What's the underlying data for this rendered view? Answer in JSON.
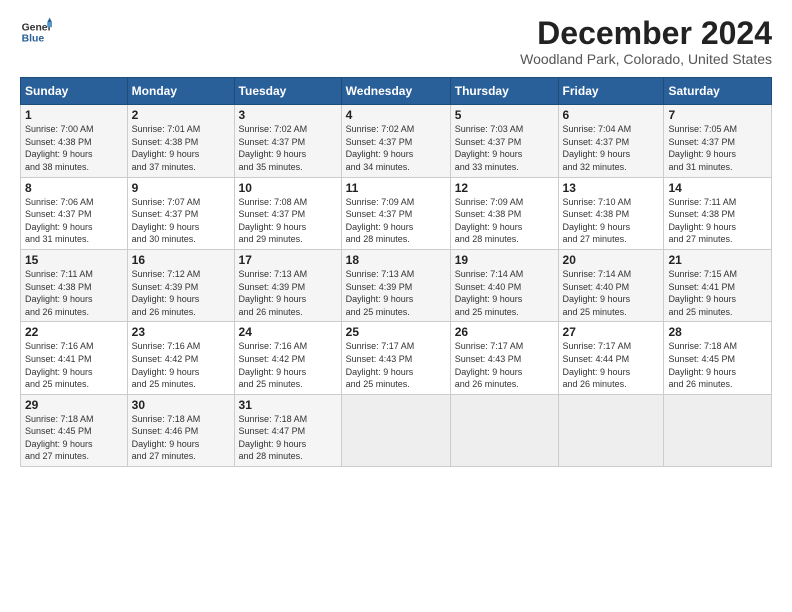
{
  "logo": {
    "line1": "General",
    "line2": "Blue"
  },
  "title": "December 2024",
  "location": "Woodland Park, Colorado, United States",
  "days_header": [
    "Sunday",
    "Monday",
    "Tuesday",
    "Wednesday",
    "Thursday",
    "Friday",
    "Saturday"
  ],
  "weeks": [
    [
      {
        "day": "1",
        "info": "Sunrise: 7:00 AM\nSunset: 4:38 PM\nDaylight: 9 hours\nand 38 minutes."
      },
      {
        "day": "2",
        "info": "Sunrise: 7:01 AM\nSunset: 4:38 PM\nDaylight: 9 hours\nand 37 minutes."
      },
      {
        "day": "3",
        "info": "Sunrise: 7:02 AM\nSunset: 4:37 PM\nDaylight: 9 hours\nand 35 minutes."
      },
      {
        "day": "4",
        "info": "Sunrise: 7:02 AM\nSunset: 4:37 PM\nDaylight: 9 hours\nand 34 minutes."
      },
      {
        "day": "5",
        "info": "Sunrise: 7:03 AM\nSunset: 4:37 PM\nDaylight: 9 hours\nand 33 minutes."
      },
      {
        "day": "6",
        "info": "Sunrise: 7:04 AM\nSunset: 4:37 PM\nDaylight: 9 hours\nand 32 minutes."
      },
      {
        "day": "7",
        "info": "Sunrise: 7:05 AM\nSunset: 4:37 PM\nDaylight: 9 hours\nand 31 minutes."
      }
    ],
    [
      {
        "day": "8",
        "info": "Sunrise: 7:06 AM\nSunset: 4:37 PM\nDaylight: 9 hours\nand 31 minutes."
      },
      {
        "day": "9",
        "info": "Sunrise: 7:07 AM\nSunset: 4:37 PM\nDaylight: 9 hours\nand 30 minutes."
      },
      {
        "day": "10",
        "info": "Sunrise: 7:08 AM\nSunset: 4:37 PM\nDaylight: 9 hours\nand 29 minutes."
      },
      {
        "day": "11",
        "info": "Sunrise: 7:09 AM\nSunset: 4:37 PM\nDaylight: 9 hours\nand 28 minutes."
      },
      {
        "day": "12",
        "info": "Sunrise: 7:09 AM\nSunset: 4:38 PM\nDaylight: 9 hours\nand 28 minutes."
      },
      {
        "day": "13",
        "info": "Sunrise: 7:10 AM\nSunset: 4:38 PM\nDaylight: 9 hours\nand 27 minutes."
      },
      {
        "day": "14",
        "info": "Sunrise: 7:11 AM\nSunset: 4:38 PM\nDaylight: 9 hours\nand 27 minutes."
      }
    ],
    [
      {
        "day": "15",
        "info": "Sunrise: 7:11 AM\nSunset: 4:38 PM\nDaylight: 9 hours\nand 26 minutes."
      },
      {
        "day": "16",
        "info": "Sunrise: 7:12 AM\nSunset: 4:39 PM\nDaylight: 9 hours\nand 26 minutes."
      },
      {
        "day": "17",
        "info": "Sunrise: 7:13 AM\nSunset: 4:39 PM\nDaylight: 9 hours\nand 26 minutes."
      },
      {
        "day": "18",
        "info": "Sunrise: 7:13 AM\nSunset: 4:39 PM\nDaylight: 9 hours\nand 25 minutes."
      },
      {
        "day": "19",
        "info": "Sunrise: 7:14 AM\nSunset: 4:40 PM\nDaylight: 9 hours\nand 25 minutes."
      },
      {
        "day": "20",
        "info": "Sunrise: 7:14 AM\nSunset: 4:40 PM\nDaylight: 9 hours\nand 25 minutes."
      },
      {
        "day": "21",
        "info": "Sunrise: 7:15 AM\nSunset: 4:41 PM\nDaylight: 9 hours\nand 25 minutes."
      }
    ],
    [
      {
        "day": "22",
        "info": "Sunrise: 7:16 AM\nSunset: 4:41 PM\nDaylight: 9 hours\nand 25 minutes."
      },
      {
        "day": "23",
        "info": "Sunrise: 7:16 AM\nSunset: 4:42 PM\nDaylight: 9 hours\nand 25 minutes."
      },
      {
        "day": "24",
        "info": "Sunrise: 7:16 AM\nSunset: 4:42 PM\nDaylight: 9 hours\nand 25 minutes."
      },
      {
        "day": "25",
        "info": "Sunrise: 7:17 AM\nSunset: 4:43 PM\nDaylight: 9 hours\nand 25 minutes."
      },
      {
        "day": "26",
        "info": "Sunrise: 7:17 AM\nSunset: 4:43 PM\nDaylight: 9 hours\nand 26 minutes."
      },
      {
        "day": "27",
        "info": "Sunrise: 7:17 AM\nSunset: 4:44 PM\nDaylight: 9 hours\nand 26 minutes."
      },
      {
        "day": "28",
        "info": "Sunrise: 7:18 AM\nSunset: 4:45 PM\nDaylight: 9 hours\nand 26 minutes."
      }
    ],
    [
      {
        "day": "29",
        "info": "Sunrise: 7:18 AM\nSunset: 4:45 PM\nDaylight: 9 hours\nand 27 minutes."
      },
      {
        "day": "30",
        "info": "Sunrise: 7:18 AM\nSunset: 4:46 PM\nDaylight: 9 hours\nand 27 minutes."
      },
      {
        "day": "31",
        "info": "Sunrise: 7:18 AM\nSunset: 4:47 PM\nDaylight: 9 hours\nand 28 minutes."
      },
      {
        "day": "",
        "info": ""
      },
      {
        "day": "",
        "info": ""
      },
      {
        "day": "",
        "info": ""
      },
      {
        "day": "",
        "info": ""
      }
    ]
  ]
}
